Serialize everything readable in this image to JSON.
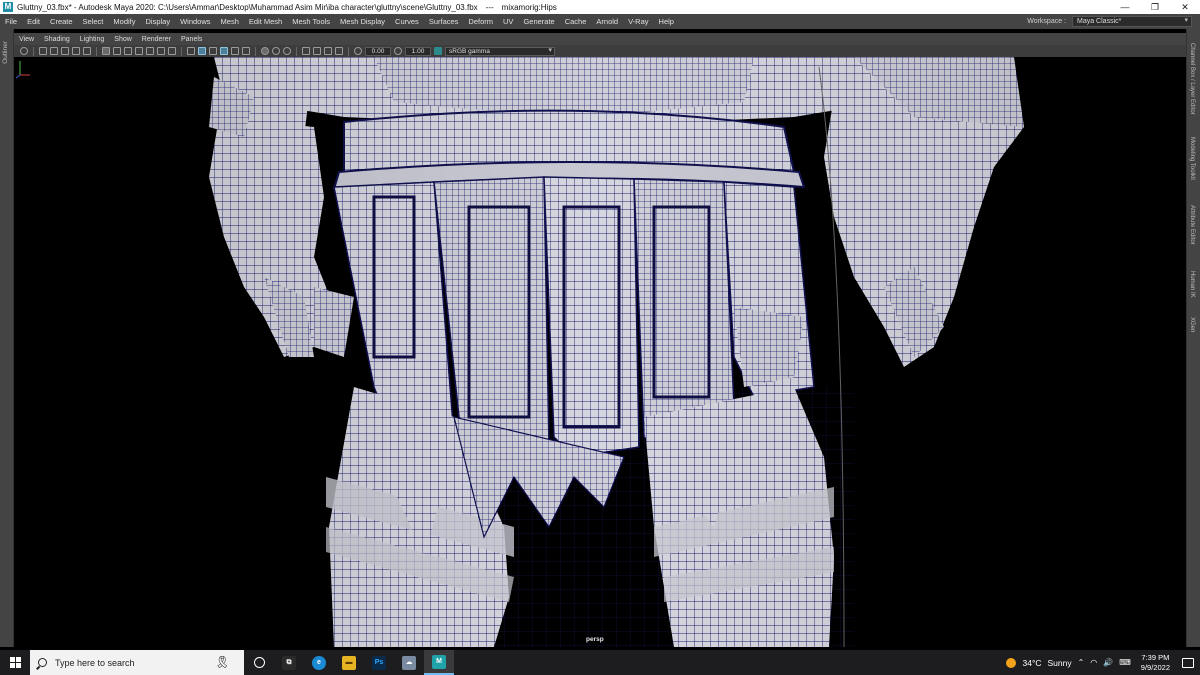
{
  "window": {
    "app_icon": "M",
    "title": "Gluttny_03.fbx* - Autodesk Maya 2020: C:\\Users\\Ammar\\Desktop\\Muhammad Asim Mir\\iba character\\gluttny\\scene\\Gluttny_03.fbx",
    "separator": "---",
    "selection": "mixamorig:Hips",
    "controls": [
      "—",
      "❐",
      "✕"
    ]
  },
  "menu": {
    "items": [
      "File",
      "Edit",
      "Create",
      "Select",
      "Modify",
      "Display",
      "Windows",
      "Mesh",
      "Edit Mesh",
      "Mesh Tools",
      "Mesh Display",
      "Curves",
      "Surfaces",
      "Deform",
      "UV",
      "Generate",
      "Cache",
      "Arnold",
      "V-Ray",
      "Help"
    ],
    "workspace_label": "Workspace :",
    "workspace_value": "Maya Classic*"
  },
  "left_strip": {
    "label": "Outliner"
  },
  "right_strip": {
    "tabs": [
      "Channel Box / Layer Editor",
      "Modeling Toolkit",
      "Attribute Editor",
      "Human IK",
      "XGen"
    ]
  },
  "panel": {
    "menu": [
      "View",
      "Shading",
      "Lighting",
      "Show",
      "Renderer",
      "Panels"
    ],
    "exposure": "0.00",
    "gamma_value": "1.00",
    "color_space": "sRGB gamma"
  },
  "viewport": {
    "camera_label": "persp",
    "mesh_color": "#d9d9e0",
    "wire_color": "#1a1a6e"
  },
  "taskbar": {
    "search_placeholder": "Type here to search",
    "pinned": [
      {
        "name": "task-view",
        "label": "⧉",
        "color": "#2a2a2a"
      },
      {
        "name": "edge",
        "label": "e",
        "color": "#1a8ad4"
      },
      {
        "name": "file-explorer",
        "label": "▬",
        "color": "#e6b422"
      },
      {
        "name": "photoshop",
        "label": "Ps",
        "color": "#0b2a4a"
      },
      {
        "name": "cloud-app",
        "label": "☁",
        "color": "#7a8aa0"
      },
      {
        "name": "maya",
        "label": "M",
        "color": "#1fa2a8"
      }
    ],
    "weather_temp": "34°C",
    "weather_desc": "Sunny",
    "time": "7:39 PM",
    "date": "9/9/2022"
  }
}
